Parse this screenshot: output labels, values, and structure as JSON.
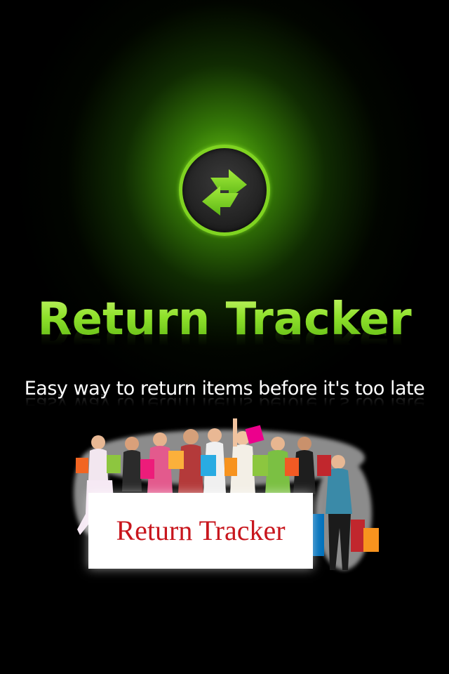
{
  "app": {
    "title": "Return Tracker",
    "tagline": "Easy way to return items before it's too late"
  },
  "icon": {
    "name": "swap-arrows-icon",
    "ring_color": "#7fd321",
    "arrow_color": "#7fd321"
  },
  "promo": {
    "image_name": "shoppers-with-bags",
    "sign_text": "Return Tracker",
    "sign_text_color": "#c8161d"
  },
  "colors": {
    "background": "#000000",
    "glow": "#6ed214",
    "title_green": "#8ee02b",
    "tagline": "#ffffff"
  }
}
